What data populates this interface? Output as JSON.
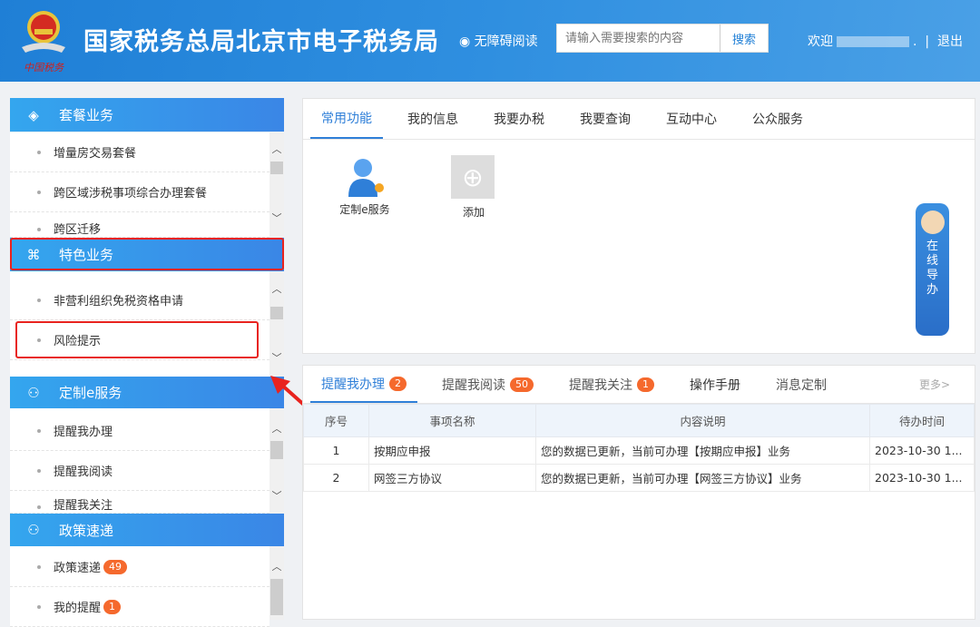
{
  "header": {
    "title": "国家税务总局北京市电子税务局",
    "logo_text": "中国税务",
    "accessibility": "无障碍阅读",
    "search_placeholder": "请输入需要搜索的内容",
    "search_button": "搜索",
    "welcome": "欢迎",
    "welcome_suffix": ".",
    "logout": "退出",
    "sep": "|"
  },
  "sidebar": {
    "sections": [
      {
        "title": "套餐业务",
        "icon": "layers-icon",
        "items": [
          "增量房交易套餐",
          "跨区域涉税事项综合办理套餐",
          "跨区迁移"
        ]
      },
      {
        "title": "特色业务",
        "icon": "grid-icon",
        "items": [
          "非营利组织免税资格申请",
          "风险提示"
        ]
      },
      {
        "title": "定制e服务",
        "icon": "user-plus-icon",
        "items": [
          "提醒我办理",
          "提醒我阅读",
          "提醒我关注"
        ]
      },
      {
        "title": "政策速递",
        "icon": "user-plus-icon",
        "items": [
          {
            "label": "政策速递",
            "badge": "49"
          },
          {
            "label": "我的提醒",
            "badge": "1"
          }
        ]
      }
    ]
  },
  "top_panel": {
    "tabs": [
      "常用功能",
      "我的信息",
      "我要办税",
      "我要查询",
      "互动中心",
      "公众服务"
    ],
    "active_tab": 0,
    "functions": [
      "定制e服务",
      "添加"
    ]
  },
  "online_guide": "在线导办",
  "bottom_panel": {
    "tabs": [
      {
        "label": "提醒我办理",
        "badge": "2"
      },
      {
        "label": "提醒我阅读",
        "badge": "50"
      },
      {
        "label": "提醒我关注",
        "badge": "1"
      },
      {
        "label": "操作手册"
      },
      {
        "label": "消息定制"
      }
    ],
    "more": "更多>",
    "columns": [
      "序号",
      "事项名称",
      "内容说明",
      "待办时间"
    ],
    "rows": [
      [
        "1",
        "按期应申报",
        "您的数据已更新，当前可办理【按期应申报】业务",
        "2023-10-30 1..."
      ],
      [
        "2",
        "网签三方协议",
        "您的数据已更新，当前可办理【网签三方协议】业务",
        "2023-10-30 1..."
      ]
    ]
  },
  "colors": {
    "accent": "#2f7fd8",
    "badge": "#f5692d",
    "highlight": "#e8231e"
  }
}
